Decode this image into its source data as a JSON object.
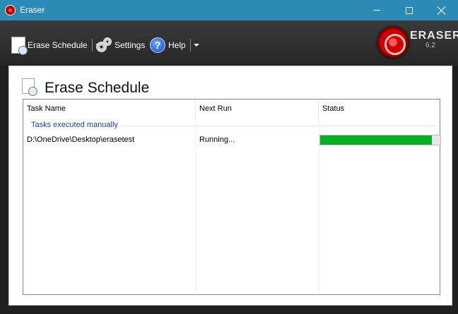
{
  "window": {
    "title": "Eraser"
  },
  "toolbar": {
    "erase_schedule_label": "Erase Schedule",
    "settings_label": "Settings",
    "help_label": "Help"
  },
  "logo": {
    "name": "ERASER",
    "version": "6.2"
  },
  "page": {
    "title": "Erase Schedule"
  },
  "table": {
    "columns": [
      "Task Name",
      "Next Run",
      "Status"
    ],
    "groups": [
      {
        "label": "Tasks executed manually",
        "rows": [
          {
            "task_name": "D:\\OneDrive\\Desktop\\erasetest",
            "next_run": "Running...",
            "progress": 0.93
          }
        ]
      }
    ]
  },
  "colors": {
    "titlebar": "#2b8ab6",
    "progress": "#06b025",
    "group": "#1e3ea8"
  }
}
